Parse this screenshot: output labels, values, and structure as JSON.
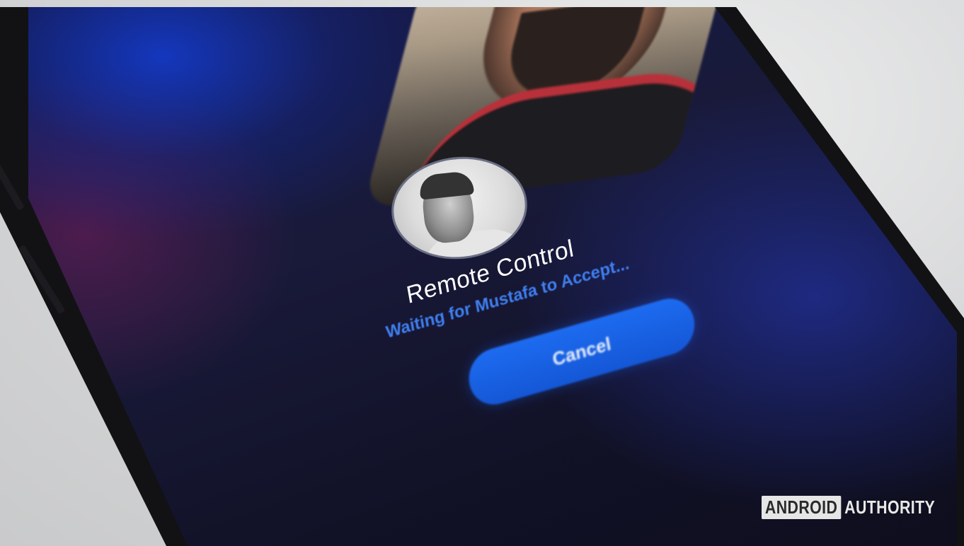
{
  "call_screen": {
    "title": "Remote Control",
    "subtitle": "Waiting for Mustafa to Accept...",
    "cancel_label": "Cancel"
  },
  "watermark": {
    "boxed": "ANDROID",
    "text": "AUTHORITY"
  },
  "colors": {
    "accent": "#1d6bf0",
    "subtitle": "#3f7ff0",
    "screen_bg": "#14184a"
  },
  "icons": {
    "avatar": "contact-avatar-photo",
    "preview": "self-camera-preview"
  }
}
